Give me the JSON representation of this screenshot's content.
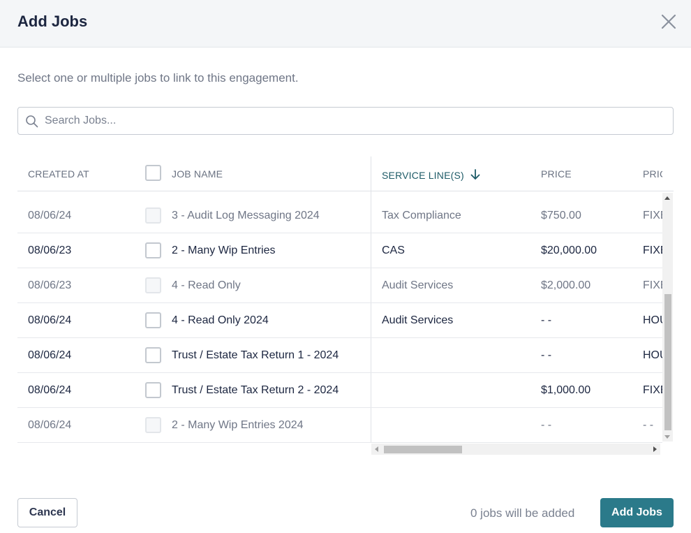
{
  "modal": {
    "title": "Add Jobs",
    "description": "Select one or multiple jobs to link to this engagement."
  },
  "search": {
    "placeholder": "Search Jobs...",
    "value": ""
  },
  "table": {
    "columns": {
      "created_at": "CREATED AT",
      "job_name": "JOB NAME",
      "service_lines": "SERVICE LINE(S)",
      "price": "PRICE",
      "pricing": "PRICII"
    },
    "sorted_column": "SERVICE LINE(S)",
    "sort_direction": "descending",
    "rows": [
      {
        "created_at": "08/06/24",
        "job_name": "3 - Audit Log Messaging 2024",
        "service_line": "Tax Compliance",
        "price": "$750.00",
        "pricing": "FIXE",
        "selectable": false
      },
      {
        "created_at": "08/06/23",
        "job_name": "2 - Many Wip Entries",
        "service_line": "CAS",
        "price": "$20,000.00",
        "pricing": "FIXE",
        "selectable": true
      },
      {
        "created_at": "08/06/23",
        "job_name": "4 - Read Only",
        "service_line": "Audit Services",
        "price": "$2,000.00",
        "pricing": "FIXE",
        "selectable": false
      },
      {
        "created_at": "08/06/24",
        "job_name": "4 - Read Only 2024",
        "service_line": "Audit Services",
        "price": "- -",
        "pricing": "HOU",
        "selectable": true
      },
      {
        "created_at": "08/06/24",
        "job_name": "Trust / Estate Tax Return 1 - 2024",
        "service_line": "",
        "price": "- -",
        "pricing": "HOU",
        "selectable": true
      },
      {
        "created_at": "08/06/24",
        "job_name": "Trust / Estate Tax Return 2 - 2024",
        "service_line": "",
        "price": "$1,000.00",
        "pricing": "FIXE",
        "selectable": true
      },
      {
        "created_at": "08/06/24",
        "job_name": "2 - Many Wip Entries 2024",
        "service_line": "",
        "price": "- -",
        "pricing": "- -",
        "selectable": false
      }
    ]
  },
  "footer": {
    "cancel_label": "Cancel",
    "count_text": "0 jobs will be added",
    "add_label": "Add Jobs"
  },
  "icons": {
    "close": "close-icon",
    "search": "search-icon",
    "sort": "arrow-down-icon"
  },
  "colors": {
    "primary": "#2b7a8a",
    "sorted_header": "#1e5b67",
    "header_bg": "#f4f6f8"
  }
}
